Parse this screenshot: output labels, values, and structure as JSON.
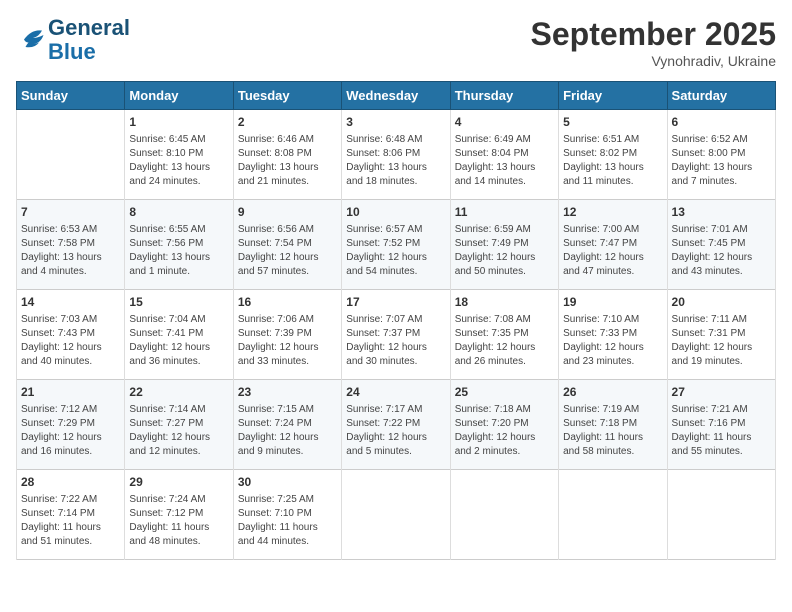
{
  "header": {
    "logo_line1": "General",
    "logo_line2": "Blue",
    "month": "September 2025",
    "location": "Vynohradiv, Ukraine"
  },
  "weekdays": [
    "Sunday",
    "Monday",
    "Tuesday",
    "Wednesday",
    "Thursday",
    "Friday",
    "Saturday"
  ],
  "weeks": [
    [
      {
        "day": "",
        "info": ""
      },
      {
        "day": "1",
        "info": "Sunrise: 6:45 AM\nSunset: 8:10 PM\nDaylight: 13 hours\nand 24 minutes."
      },
      {
        "day": "2",
        "info": "Sunrise: 6:46 AM\nSunset: 8:08 PM\nDaylight: 13 hours\nand 21 minutes."
      },
      {
        "day": "3",
        "info": "Sunrise: 6:48 AM\nSunset: 8:06 PM\nDaylight: 13 hours\nand 18 minutes."
      },
      {
        "day": "4",
        "info": "Sunrise: 6:49 AM\nSunset: 8:04 PM\nDaylight: 13 hours\nand 14 minutes."
      },
      {
        "day": "5",
        "info": "Sunrise: 6:51 AM\nSunset: 8:02 PM\nDaylight: 13 hours\nand 11 minutes."
      },
      {
        "day": "6",
        "info": "Sunrise: 6:52 AM\nSunset: 8:00 PM\nDaylight: 13 hours\nand 7 minutes."
      }
    ],
    [
      {
        "day": "7",
        "info": "Sunrise: 6:53 AM\nSunset: 7:58 PM\nDaylight: 13 hours\nand 4 minutes."
      },
      {
        "day": "8",
        "info": "Sunrise: 6:55 AM\nSunset: 7:56 PM\nDaylight: 13 hours\nand 1 minute."
      },
      {
        "day": "9",
        "info": "Sunrise: 6:56 AM\nSunset: 7:54 PM\nDaylight: 12 hours\nand 57 minutes."
      },
      {
        "day": "10",
        "info": "Sunrise: 6:57 AM\nSunset: 7:52 PM\nDaylight: 12 hours\nand 54 minutes."
      },
      {
        "day": "11",
        "info": "Sunrise: 6:59 AM\nSunset: 7:49 PM\nDaylight: 12 hours\nand 50 minutes."
      },
      {
        "day": "12",
        "info": "Sunrise: 7:00 AM\nSunset: 7:47 PM\nDaylight: 12 hours\nand 47 minutes."
      },
      {
        "day": "13",
        "info": "Sunrise: 7:01 AM\nSunset: 7:45 PM\nDaylight: 12 hours\nand 43 minutes."
      }
    ],
    [
      {
        "day": "14",
        "info": "Sunrise: 7:03 AM\nSunset: 7:43 PM\nDaylight: 12 hours\nand 40 minutes."
      },
      {
        "day": "15",
        "info": "Sunrise: 7:04 AM\nSunset: 7:41 PM\nDaylight: 12 hours\nand 36 minutes."
      },
      {
        "day": "16",
        "info": "Sunrise: 7:06 AM\nSunset: 7:39 PM\nDaylight: 12 hours\nand 33 minutes."
      },
      {
        "day": "17",
        "info": "Sunrise: 7:07 AM\nSunset: 7:37 PM\nDaylight: 12 hours\nand 30 minutes."
      },
      {
        "day": "18",
        "info": "Sunrise: 7:08 AM\nSunset: 7:35 PM\nDaylight: 12 hours\nand 26 minutes."
      },
      {
        "day": "19",
        "info": "Sunrise: 7:10 AM\nSunset: 7:33 PM\nDaylight: 12 hours\nand 23 minutes."
      },
      {
        "day": "20",
        "info": "Sunrise: 7:11 AM\nSunset: 7:31 PM\nDaylight: 12 hours\nand 19 minutes."
      }
    ],
    [
      {
        "day": "21",
        "info": "Sunrise: 7:12 AM\nSunset: 7:29 PM\nDaylight: 12 hours\nand 16 minutes."
      },
      {
        "day": "22",
        "info": "Sunrise: 7:14 AM\nSunset: 7:27 PM\nDaylight: 12 hours\nand 12 minutes."
      },
      {
        "day": "23",
        "info": "Sunrise: 7:15 AM\nSunset: 7:24 PM\nDaylight: 12 hours\nand 9 minutes."
      },
      {
        "day": "24",
        "info": "Sunrise: 7:17 AM\nSunset: 7:22 PM\nDaylight: 12 hours\nand 5 minutes."
      },
      {
        "day": "25",
        "info": "Sunrise: 7:18 AM\nSunset: 7:20 PM\nDaylight: 12 hours\nand 2 minutes."
      },
      {
        "day": "26",
        "info": "Sunrise: 7:19 AM\nSunset: 7:18 PM\nDaylight: 11 hours\nand 58 minutes."
      },
      {
        "day": "27",
        "info": "Sunrise: 7:21 AM\nSunset: 7:16 PM\nDaylight: 11 hours\nand 55 minutes."
      }
    ],
    [
      {
        "day": "28",
        "info": "Sunrise: 7:22 AM\nSunset: 7:14 PM\nDaylight: 11 hours\nand 51 minutes."
      },
      {
        "day": "29",
        "info": "Sunrise: 7:24 AM\nSunset: 7:12 PM\nDaylight: 11 hours\nand 48 minutes."
      },
      {
        "day": "30",
        "info": "Sunrise: 7:25 AM\nSunset: 7:10 PM\nDaylight: 11 hours\nand 44 minutes."
      },
      {
        "day": "",
        "info": ""
      },
      {
        "day": "",
        "info": ""
      },
      {
        "day": "",
        "info": ""
      },
      {
        "day": "",
        "info": ""
      }
    ]
  ]
}
